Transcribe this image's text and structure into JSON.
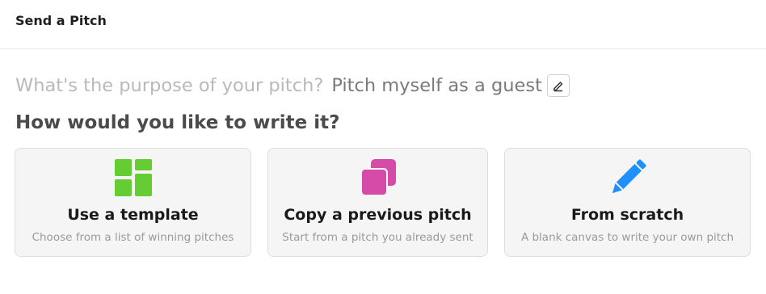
{
  "header": {
    "title": "Send a Pitch"
  },
  "purpose": {
    "question": "What's the purpose of your pitch?",
    "value": "Pitch myself as a guest",
    "edit_icon": "pencil-outline-icon"
  },
  "write_heading": "How would you like to write it?",
  "options": [
    {
      "title": "Use a template",
      "subtitle": "Choose from a list of winning pitches",
      "icon": "grid-icon",
      "color": "#66cc33"
    },
    {
      "title": "Copy a previous pitch",
      "subtitle": "Start from a pitch you already sent",
      "icon": "copy-icon",
      "color": "#d64aa8"
    },
    {
      "title": "From scratch",
      "subtitle": "A blank canvas to write your own pitch",
      "icon": "pencil-icon",
      "color": "#1e90ff"
    }
  ]
}
